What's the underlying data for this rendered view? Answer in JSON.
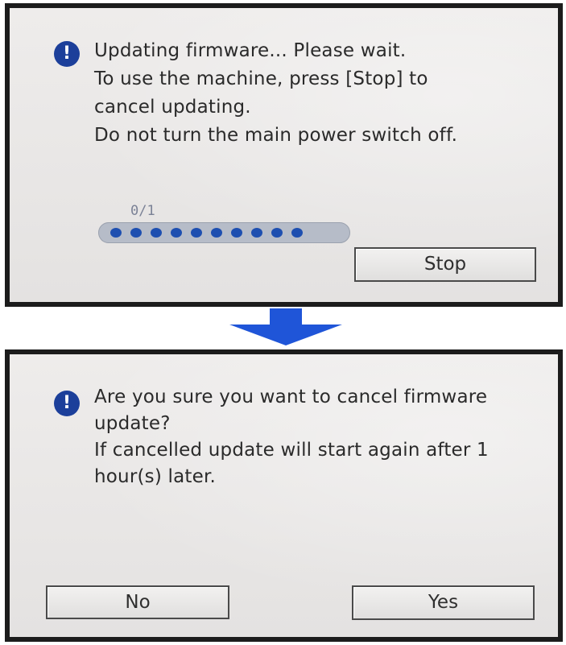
{
  "firmware_dialog": {
    "lines": [
      "Updating firmware... Please wait.",
      "To use the machine, press [Stop] to",
      "cancel updating.",
      "Do not turn the main power switch off."
    ],
    "progress_text": "0/1",
    "progress": {
      "completed": 0,
      "total": 1
    },
    "stop_label": "Stop"
  },
  "confirm_dialog": {
    "lines": [
      "Are you sure you want to cancel firmware",
      "update?",
      "If cancelled update will start again after 1",
      "hour(s) later."
    ],
    "no_label": "No",
    "yes_label": "Yes"
  },
  "icons": {
    "alert": "exclamation-circle-icon",
    "flow_arrow": "down-arrow-icon"
  },
  "colors": {
    "accent": "#1c3f9a",
    "arrow": "#1f55d8",
    "panel_background": "#e9e7e6",
    "panel_border": "#4a7fd0"
  }
}
